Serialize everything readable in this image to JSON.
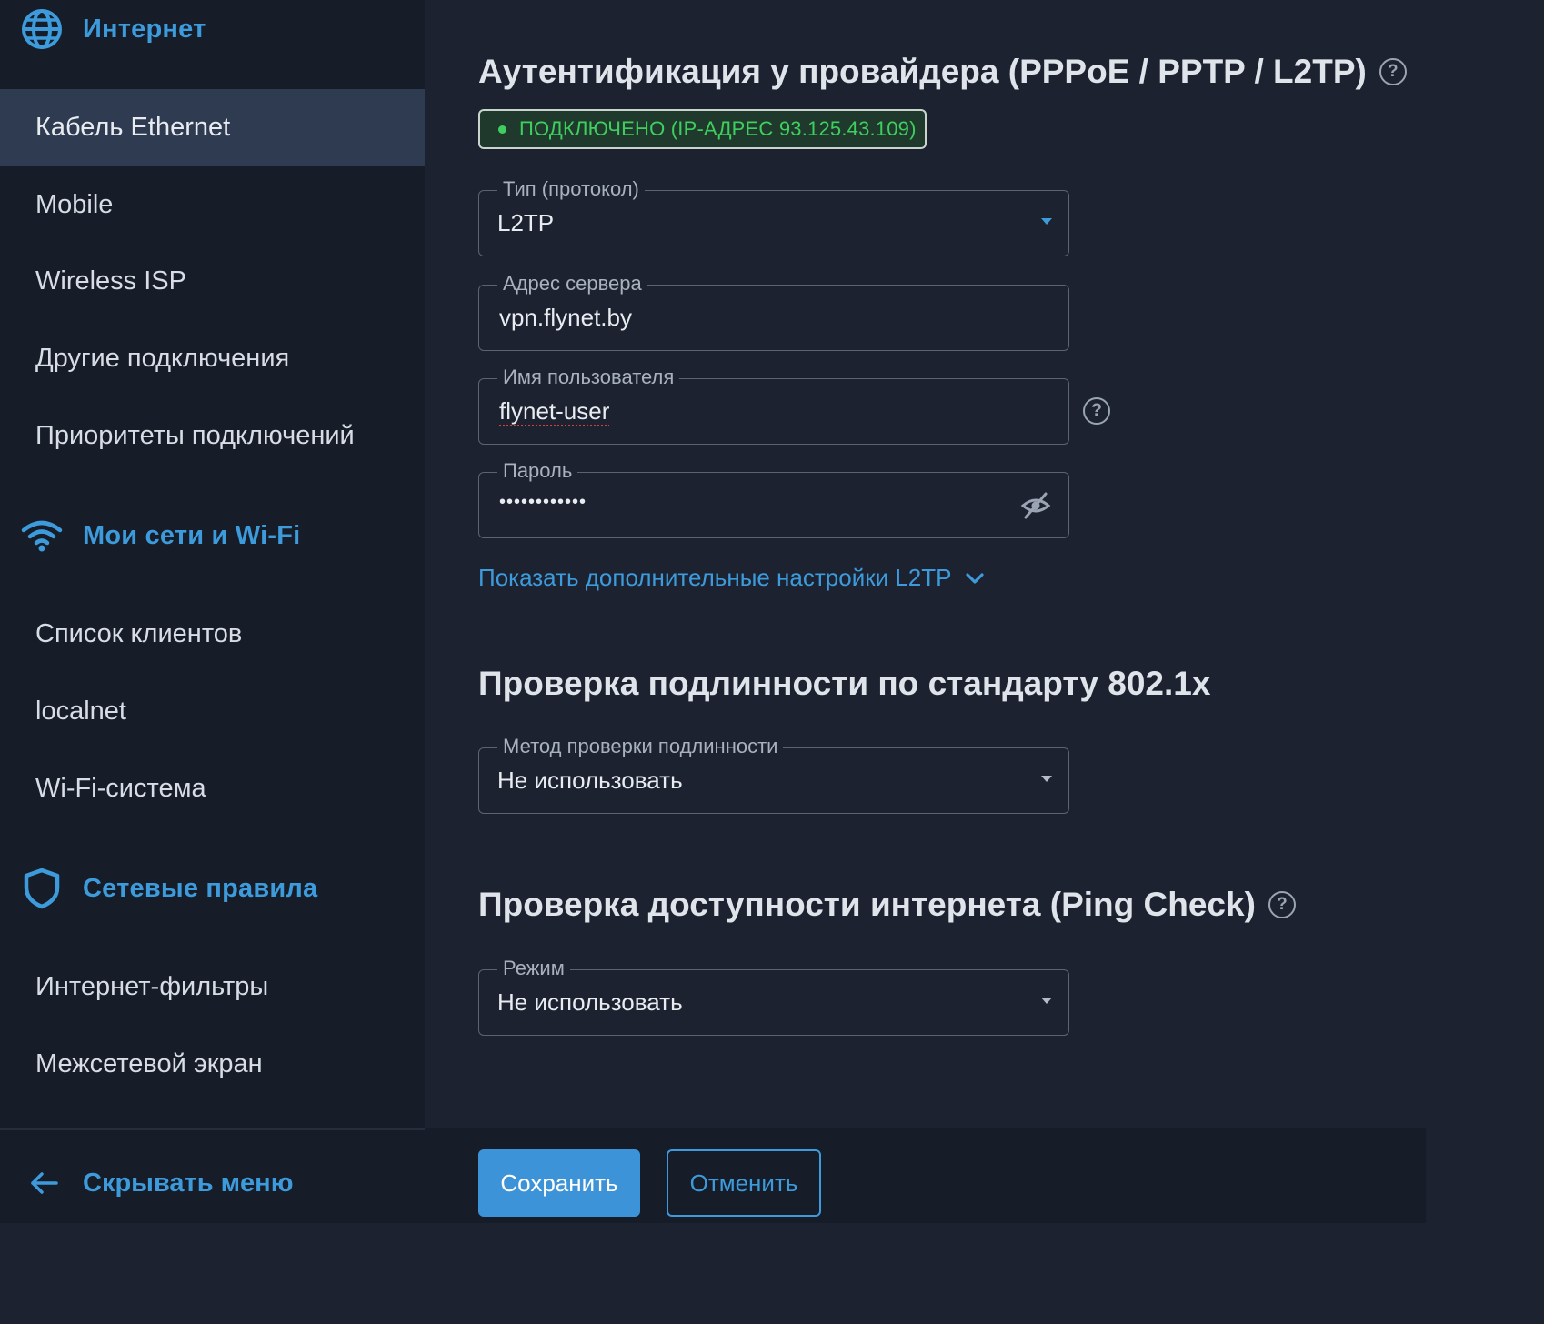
{
  "sidebar": {
    "sections": [
      {
        "title": "Интернет",
        "icon": "globe-icon"
      },
      {
        "title": "Мои сети и Wi-Fi",
        "icon": "wifi-icon"
      },
      {
        "title": "Сетевые правила",
        "icon": "shield-icon"
      }
    ],
    "internet_items": [
      "Кабель Ethernet",
      "Mobile",
      "Wireless ISP",
      "Другие подключения",
      "Приоритеты подключений"
    ],
    "networks_items": [
      "Список клиентов",
      "localnet",
      "Wi-Fi-система"
    ],
    "rules_items": [
      "Интернет-фильтры",
      "Межсетевой экран"
    ],
    "active_item": "Кабель Ethernet",
    "collapse_label": "Скрывать меню"
  },
  "main": {
    "auth_title": "Аутентификация у провайдера (PPPoE / PPTP / L2TP)",
    "status_text": "ПОДКЛЮЧЕНО (IP-АДРЕС 93.125.43.109)",
    "protocol": {
      "label": "Тип (протокол)",
      "value": "L2TP"
    },
    "server": {
      "label": "Адрес сервера",
      "value": "vpn.flynet.by"
    },
    "username": {
      "label": "Имя пользователя",
      "value": "flynet-user"
    },
    "password": {
      "label": "Пароль",
      "value": "••••••••••••"
    },
    "advanced_link": "Показать дополнительные настройки L2TP",
    "dot1x_title": "Проверка подлинности по стандарту 802.1x",
    "dot1x_method": {
      "label": "Метод проверки подлинности",
      "value": "Не использовать"
    },
    "ping_title": "Проверка доступности интернета (Ping Check)",
    "ping_mode": {
      "label": "Режим",
      "value": "Не использовать"
    }
  },
  "footer": {
    "save_label": "Сохранить",
    "cancel_label": "Отменить"
  },
  "colors": {
    "accent": "#3d9bdc",
    "status_green": "#3fcf5f",
    "sidebar_bg": "#161c28",
    "main_bg": "#1c2230",
    "active_item_bg": "#2e3b50"
  }
}
